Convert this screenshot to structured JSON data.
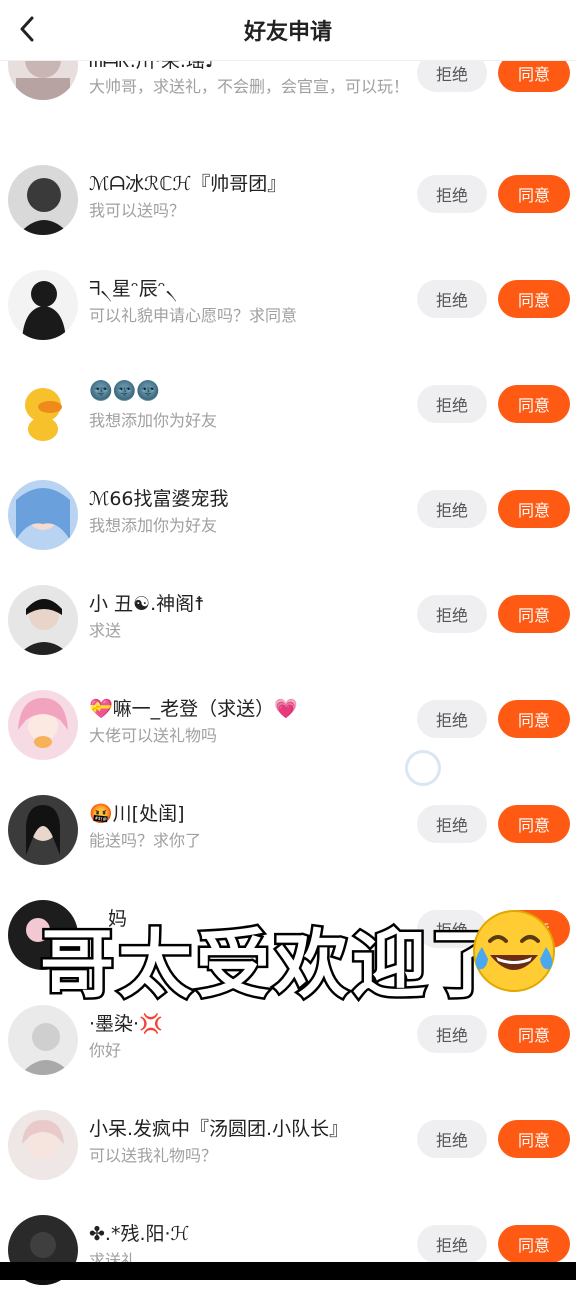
{
  "header": {
    "title": "好友申请",
    "back_icon": "chevron-left-icon"
  },
  "buttons": {
    "reject": "拒绝",
    "agree": "同意"
  },
  "requests": [
    {
      "name": "ᗰᗩᖇ.川·荣.瑶♪",
      "message": "大帅哥，求送礼，不会删，会官宣，可以玩！"
    },
    {
      "name": "ℳᗩ冰ℛℂℋ『帅哥团』",
      "message": "我可以送吗？"
    },
    {
      "name": "ᖷ৲星ᵔ辰ᵔ৲",
      "message": "可以礼貌申请心愿吗？求同意"
    },
    {
      "name": "🌚🌚🌚",
      "message": "我想添加你为好友"
    },
    {
      "name": "ℳ66找富婆宠我",
      "message": "我想添加你为好友"
    },
    {
      "name": "小 丑☯.神阁☨",
      "message": "求送"
    },
    {
      "name": "💝嘛一_老登（求送）💗",
      "message": "大佬可以送礼物吗"
    },
    {
      "name": "🤬川[处闺]",
      "message": "能送吗？求你了"
    },
    {
      "name": "妈",
      "message": ""
    },
    {
      "name": "·墨染·💢",
      "message": "你好"
    },
    {
      "name": "小呆.发疯中『汤圆团.小队长』",
      "message": "可以送我礼物吗？"
    },
    {
      "name": "✤.*残.阳·ℋ",
      "message": "求送礼"
    }
  ],
  "overlay": {
    "caption": "哥太受欢迎了",
    "emoji": "laughing-tears-emoji"
  },
  "colors": {
    "agree": "#fe5a14",
    "reject_bg": "#efeff2",
    "message_text": "#a0a0a0"
  }
}
